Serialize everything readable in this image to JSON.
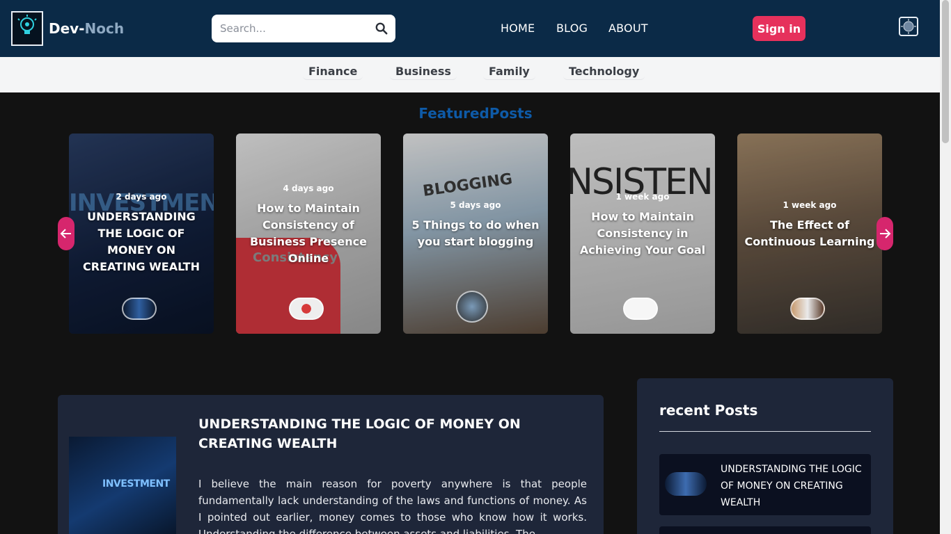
{
  "header": {
    "brand_part1": "Dev-",
    "brand_part2": "Noch",
    "logo_text": "Dev-Noch",
    "search_placeholder": "Search...",
    "nav": [
      "HOME",
      "BLOG",
      "ABOUT"
    ],
    "signin_label": "Sign in"
  },
  "categories": [
    "Finance",
    "Business",
    "Family",
    "Technology"
  ],
  "featured": {
    "heading": "FeaturedPosts",
    "cards": [
      {
        "date": "2 days ago",
        "title": "UNDERSTANDING THE LOGIC OF MONEY ON CREATING WEALTH",
        "bg_word": "INVESTMEN"
      },
      {
        "date": "4 days ago",
        "title": "How to Maintain Consistency of Business Presence Online",
        "bg_word": "Consistency"
      },
      {
        "date": "5 days ago",
        "title": "5 Things to do when you start blogging",
        "bg_word": "BLOGGING"
      },
      {
        "date": "1 week ago",
        "title": "How to Maintain Consistency in Achieving Your Goal",
        "bg_word": "NSISTEN"
      },
      {
        "date": "1 week ago",
        "title": "The Effect of Continuous Learning",
        "bg_word": ""
      }
    ]
  },
  "post": {
    "title": "UNDERSTANDING THE LOGIC OF MONEY ON CREATING WEALTH",
    "body": "I believe the main reason for poverty anywhere is that people fundamentally lack understanding of the laws and functions of money. As I pointed out earlier, money comes to those who know how it works. Understanding the difference between assets and liabilities. The",
    "image_word": "INVESTMENT"
  },
  "recent": {
    "heading": "recent Posts",
    "items": [
      {
        "title": "UNDERSTANDING THE LOGIC OF MONEY ON CREATING WEALTH"
      }
    ]
  },
  "colors": {
    "header_bg": "#0b2a47",
    "accent_pink": "#e6315c",
    "featured_heading": "#0e5aa7",
    "panel_bg": "#1e2639"
  },
  "icons": [
    "logo-bulb-icon",
    "search-icon",
    "theme-toggle-icon",
    "arrow-left-icon",
    "arrow-right-icon"
  ]
}
